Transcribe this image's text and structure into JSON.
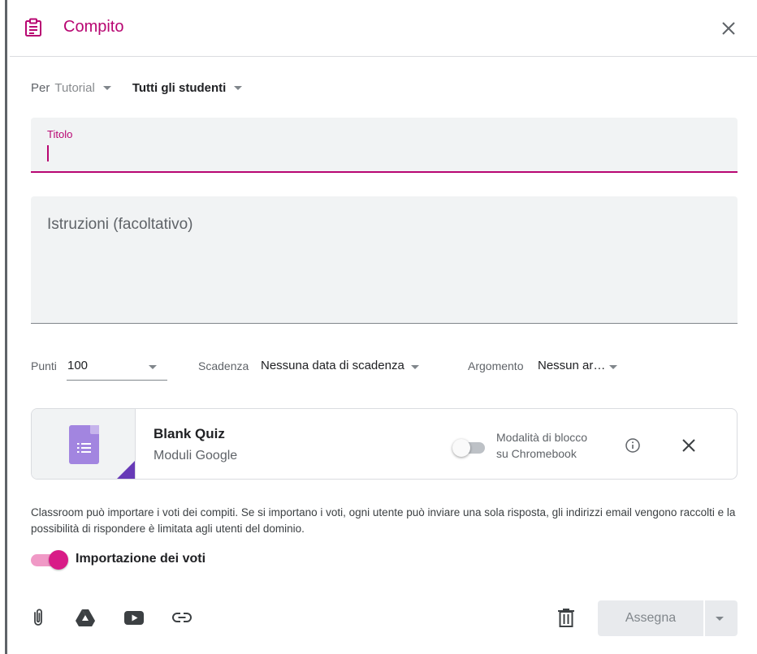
{
  "header": {
    "title": "Compito",
    "icon": "assignment-clipboard-icon",
    "accent_color": "#b80672"
  },
  "audience": {
    "for_label": "Per",
    "class_value": "Tutorial",
    "students_value": "Tutti gli studenti"
  },
  "title_field": {
    "label": "Titolo",
    "value": ""
  },
  "instructions_field": {
    "placeholder": "Istruzioni (facoltativo)"
  },
  "meta": {
    "points_label": "Punti",
    "points_value": "100",
    "due_label": "Scadenza",
    "due_value": "Nessuna data di scadenza",
    "topic_label": "Argomento",
    "topic_value": "Nessun ar…"
  },
  "attachment": {
    "title": "Blank Quiz",
    "subtitle": "Moduli Google",
    "lock_mode_label_line1": "Modalità di blocco",
    "lock_mode_label_line2": "su Chromebook",
    "lock_mode_enabled": false,
    "forms_color": "#a285e0"
  },
  "grades_info": "Classroom può importare i voti dei compiti. Se si importano i voti, ogni utente può inviare una sola risposta, gli indirizzi email vengono raccolti e la possibilità di rispondere è limitata agli utenti del dominio.",
  "grade_import": {
    "label": "Importazione dei voti",
    "enabled": true,
    "color": "#d81b87"
  },
  "toolbar": {
    "icons": [
      "attach-icon",
      "drive-icon",
      "youtube-icon",
      "link-icon"
    ],
    "delete_icon": "trash-icon",
    "assign_label": "Assegna"
  }
}
